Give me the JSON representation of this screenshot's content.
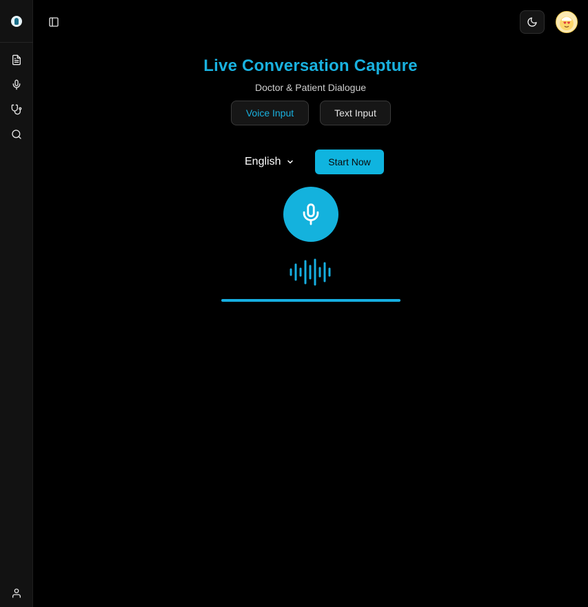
{
  "sidebar": {
    "items": [
      {
        "name": "documents",
        "icon": "file-text-icon"
      },
      {
        "name": "voice",
        "icon": "microphone-icon"
      },
      {
        "name": "clinical",
        "icon": "stethoscope-icon"
      },
      {
        "name": "search",
        "icon": "search-icon"
      }
    ],
    "footer_icon": "user-icon"
  },
  "header": {
    "panel_toggle_icon": "sidebar-toggle-icon",
    "theme_icon": "moon-icon",
    "avatar_icon": "avatar-emoji-icon"
  },
  "main": {
    "title": "Live Conversation Capture",
    "subtitle": "Doctor & Patient Dialogue",
    "tabs": [
      {
        "label": "Voice Input",
        "active": true
      },
      {
        "label": "Text Input",
        "active": false
      }
    ],
    "language": {
      "selected": "English"
    },
    "start_label": "Start Now",
    "recording_level": 1.0
  },
  "colors": {
    "accent": "#19b1df",
    "background": "#000000",
    "sidebar": "#121212"
  }
}
